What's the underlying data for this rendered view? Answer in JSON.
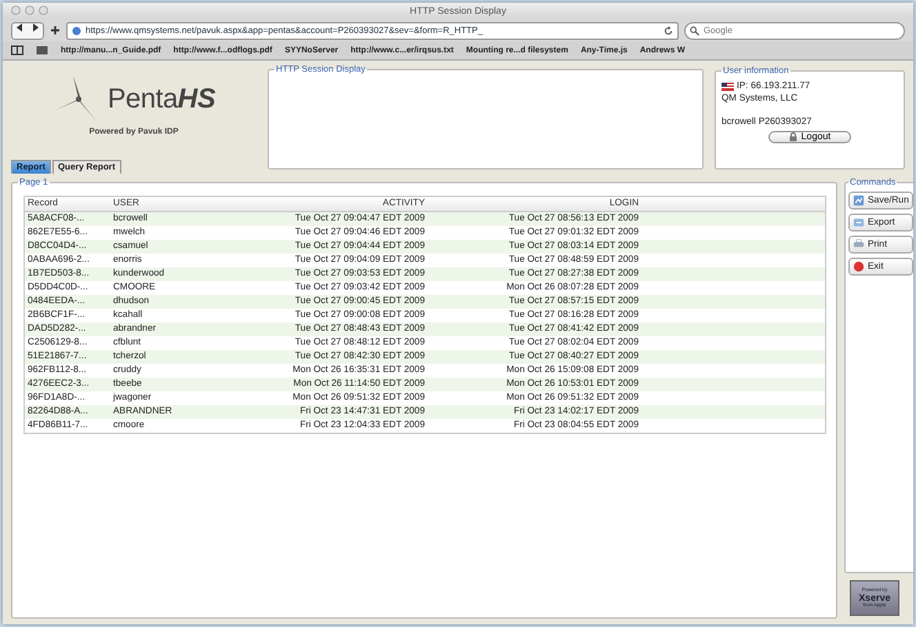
{
  "window": {
    "title": "HTTP Session Display"
  },
  "toolbar": {
    "url": "https://www.qmsystems.net/pavuk.aspx&app=pentas&account=P260393027&sev=&form=R_HTTP_",
    "search_placeholder": "Google"
  },
  "bookmarks": [
    "http://manu...n_Guide.pdf",
    "http://www.f...odflogs.pdf",
    "SYYNoServer",
    "http://www.c...er/irqsus.txt",
    "Mounting re...d filesystem",
    "Any-Time.js",
    "Andrews W"
  ],
  "logo": {
    "name": "Penta**HS**",
    "tagline": "Powered by Pavuk IDP"
  },
  "tabs": [
    {
      "label": "Report",
      "selected": true
    },
    {
      "label": "Query Report",
      "selected": false
    }
  ],
  "session_panel": {
    "title": "HTTP Session Display"
  },
  "user_info": {
    "title": "User information",
    "ip": "IP: 66.193.211.77",
    "company": "QM Systems, LLC",
    "user": "bcrowell P260393027",
    "logout": "Logout"
  },
  "report": {
    "title": "Page 1",
    "columns": [
      "Record",
      "USER",
      "ACTIVITY",
      "LOGIN"
    ],
    "rows": [
      [
        "5A8ACF08-...",
        "bcrowell",
        "Tue Oct 27 09:04:47 EDT 2009",
        "Tue Oct 27 08:56:13 EDT 2009"
      ],
      [
        "862E7E55-6...",
        "mwelch",
        "Tue Oct 27 09:04:46 EDT 2009",
        "Tue Oct 27 09:01:32 EDT 2009"
      ],
      [
        "D8CC04D4-...",
        "csamuel",
        "Tue Oct 27 09:04:44 EDT 2009",
        "Tue Oct 27 08:03:14 EDT 2009"
      ],
      [
        "0ABAA696-2...",
        "enorris",
        "Tue Oct 27 09:04:09 EDT 2009",
        "Tue Oct 27 08:48:59 EDT 2009"
      ],
      [
        "1B7ED503-8...",
        "kunderwood",
        "Tue Oct 27 09:03:53 EDT 2009",
        "Tue Oct 27 08:27:38 EDT 2009"
      ],
      [
        "D5DD4C0D-...",
        "CMOORE",
        "Tue Oct 27 09:03:42 EDT 2009",
        "Mon Oct 26 08:07:28 EDT 2009"
      ],
      [
        "0484EEDA-...",
        "dhudson",
        "Tue Oct 27 09:00:45 EDT 2009",
        "Tue Oct 27 08:57:15 EDT 2009"
      ],
      [
        "2B6BCF1F-...",
        "kcahall",
        "Tue Oct 27 09:00:08 EDT 2009",
        "Tue Oct 27 08:16:28 EDT 2009"
      ],
      [
        "DAD5D282-...",
        "abrandner",
        "Tue Oct 27 08:48:43 EDT 2009",
        "Tue Oct 27 08:41:42 EDT 2009"
      ],
      [
        "C2506129-8...",
        "cfblunt",
        "Tue Oct 27 08:48:12 EDT 2009",
        "Tue Oct 27 08:02:04 EDT 2009"
      ],
      [
        "51E21867-7...",
        "tcherzol",
        "Tue Oct 27 08:42:30 EDT 2009",
        "Tue Oct 27 08:40:27 EDT 2009"
      ],
      [
        "962FB112-8...",
        "cruddy",
        "Mon Oct 26 16:35:31 EDT 2009",
        "Mon Oct 26 15:09:08 EDT 2009"
      ],
      [
        "4276EEC2-3...",
        "tbeebe",
        "Mon Oct 26 11:14:50 EDT 2009",
        "Mon Oct 26 10:53:01 EDT 2009"
      ],
      [
        "96FD1A8D-...",
        "jwagoner",
        "Mon Oct 26 09:51:32 EDT 2009",
        "Mon Oct 26 09:51:32 EDT 2009"
      ],
      [
        "82264D88-A...",
        "ABRANDNER",
        "Fri Oct 23 14:47:31 EDT 2009",
        "Fri Oct 23 14:02:17 EDT 2009"
      ],
      [
        "4FD86B11-7...",
        "cmoore",
        "Fri Oct 23 12:04:33 EDT 2009",
        "Fri Oct 23 08:04:55 EDT 2009"
      ]
    ]
  },
  "commands": {
    "title": "Commands",
    "buttons": [
      {
        "label": "Save/Run",
        "kind": "save"
      },
      {
        "label": "Export",
        "kind": "export"
      },
      {
        "label": "Print",
        "kind": "print"
      },
      {
        "label": "Exit",
        "kind": "exit"
      }
    ]
  },
  "badge": {
    "top": "Powered by",
    "name": "Xserve",
    "bottom": "from Apple"
  }
}
